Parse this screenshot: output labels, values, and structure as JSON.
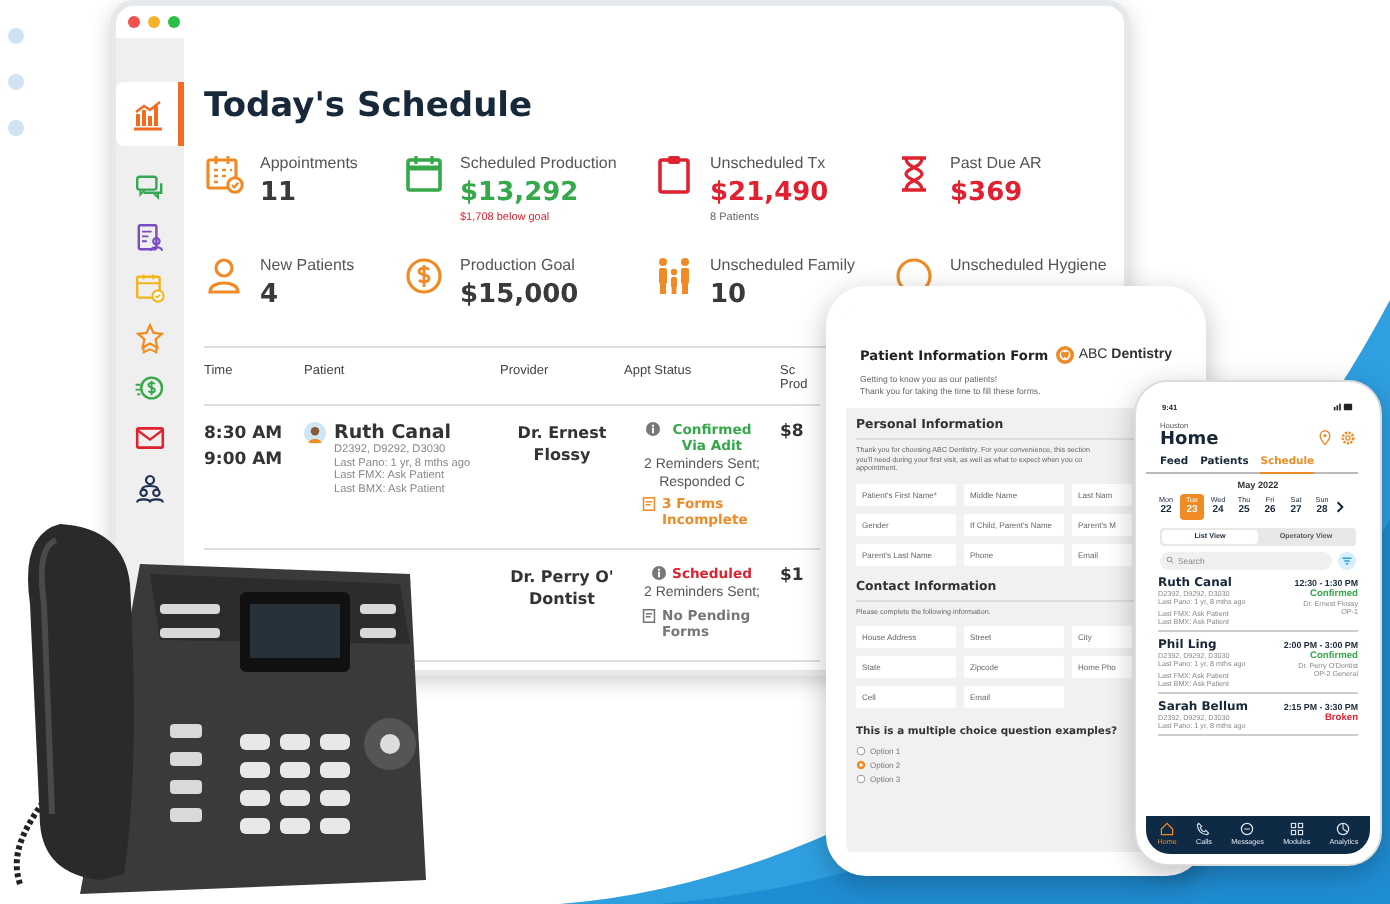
{
  "monitor": {
    "sidebar": {
      "items": [
        {
          "selected": true
        },
        {
          "selected": false
        },
        {
          "selected": false
        },
        {
          "selected": false
        },
        {
          "selected": false
        },
        {
          "selected": false
        },
        {
          "selected": false
        },
        {
          "selected": false
        }
      ]
    },
    "title": "Today's Schedule",
    "stats": [
      {
        "label": "Appointments",
        "value": "11"
      },
      {
        "label": "Scheduled Production",
        "value": "$13,292",
        "color": "#35a94a",
        "note": {
          "text": "$1,708 below goal",
          "color": "#e0212f"
        }
      },
      {
        "label": "Unscheduled Tx",
        "value": "$21,490",
        "color": "#e0212f",
        "note": {
          "text": "8 Patients"
        }
      },
      {
        "label": "Past Due AR",
        "value": "$369",
        "color": "#e0212f"
      },
      {
        "label": "New Patients",
        "value": "4"
      },
      {
        "label": "Production Goal",
        "value": "$15,000"
      },
      {
        "label": "Unscheduled Family",
        "value": "10"
      },
      {
        "label": "Unscheduled Hygiene"
      }
    ],
    "table": {
      "columns": [
        "Time",
        "Patient",
        "Provider",
        "Appt Status",
        "Sc Prod"
      ],
      "rows": [
        {
          "times": [
            "8:30 AM",
            "9:00 AM"
          ],
          "patient": {
            "name": "Ruth Canal",
            "details": [
              "D2392, D9292, D3030",
              "Last Pano: 1 yr, 8 mths ago",
              "Last FMX: Ask Patient",
              "Last BMX: Ask Patient"
            ]
          },
          "provider": "Dr. Ernest Flossy",
          "status": {
            "label": "Confirmed Via Adit",
            "color": "#35a94a",
            "note": "2 Reminders Sent; Responded C",
            "forms": {
              "label": "3 Forms Incomplete",
              "color": "#f08a24"
            }
          },
          "production": "$8"
        },
        {
          "provider": "Dr. Perry O' Dontist",
          "status": {
            "label": "Scheduled",
            "color": "#e0212f",
            "note": "2 Reminders Sent;",
            "forms": {
              "label": "No Pending Forms",
              "color": "#777777"
            }
          },
          "production": "$1"
        }
      ]
    }
  },
  "tablet": {
    "title": "Patient Information Form",
    "logo": "ABC **Dentistry**",
    "intro": [
      "Getting to know you as our patients!",
      "Thank you for taking the time to fill these forms."
    ],
    "sections": [
      {
        "heading": "Personal Information",
        "lines": [
          "Thank you for choosing ABC Dentistry. For your convenience, this section",
          "you'll need during your first visit, as well as what to expect when you co",
          "appointment."
        ],
        "fields": [
          "Patient's First Name*",
          "Middle Name",
          "Last Nam",
          "Gender",
          "If Child, Parent's Name",
          "Parent's M",
          "Parent's Last Name",
          "Phone",
          "Email"
        ]
      },
      {
        "heading": "Contact Information",
        "lines": [
          "Please complete the following information."
        ],
        "fields": [
          "House Address",
          "Street",
          "City",
          "State",
          "Zipcode",
          "Home Pho",
          "Cell",
          "Email"
        ]
      }
    ],
    "question": "This is a multiple choice question examples?",
    "options": [
      {
        "label": "Option 1",
        "selected": false
      },
      {
        "label": "Option 2",
        "selected": true
      },
      {
        "label": "Option 3",
        "selected": false
      }
    ]
  },
  "phone": {
    "time": "9:41",
    "location": "Houston",
    "title": "Home",
    "tabs": [
      {
        "label": "Feed",
        "selected": false
      },
      {
        "label": "Patients",
        "selected": false
      },
      {
        "label": "Schedule",
        "selected": true
      }
    ],
    "month": "May 2022",
    "days": [
      {
        "day": "Mon",
        "date": "22",
        "selected": false
      },
      {
        "day": "Tue",
        "date": "23",
        "selected": true
      },
      {
        "day": "Wed",
        "date": "24",
        "selected": false
      },
      {
        "day": "Thu",
        "date": "25",
        "selected": false
      },
      {
        "day": "Fri",
        "date": "26",
        "selected": false
      },
      {
        "day": "Sat",
        "date": "27",
        "selected": false
      },
      {
        "day": "Sun",
        "date": "28",
        "selected": false
      }
    ],
    "views": [
      {
        "label": "List View",
        "selected": true
      },
      {
        "label": "Operatory View",
        "selected": false
      }
    ],
    "search": {
      "placeholder": "Search"
    },
    "appointments": [
      {
        "name": "Ruth Canal",
        "time": "12:30 - 1:30 PM",
        "details": [
          "D2392, D9292, D3030",
          "Last Pano: 1 yr, 8 mths ago"
        ],
        "more": [
          "Last FMX: Ask Patient",
          "Last BMX: Ask Patient"
        ],
        "status": {
          "label": "Confirmed",
          "color": "#35a94a"
        },
        "provider": [
          "Dr. Ernest Flossy",
          "OP-1"
        ]
      },
      {
        "name": "Phil Ling",
        "time": "2:00 PM - 3:00 PM",
        "details": [
          "D2392, D9292, D3030",
          "Last Pano: 1 yr, 8 mths ago"
        ],
        "more": [
          "Last FMX: Ask Patient",
          "Last BMX: Ask Patient"
        ],
        "status": {
          "label": "Confirmed",
          "color": "#35a94a"
        },
        "provider": [
          "Dr. Perry O'Dontist",
          "OP-2 General"
        ]
      },
      {
        "name": "Sarah Bellum",
        "time": "2:15 PM - 3:30 PM",
        "details": [
          "D2392, D9292, D3030",
          "Last Pano: 1 yr, 8 mths ago"
        ],
        "status": {
          "label": "Broken",
          "color": "#e0212f"
        }
      }
    ],
    "nav": [
      {
        "label": "Home",
        "selected": true
      },
      {
        "label": "Calls",
        "selected": false
      },
      {
        "label": "Messages",
        "selected": false
      },
      {
        "label": "Modules",
        "selected": false
      },
      {
        "label": "Analytics",
        "selected": false
      }
    ]
  }
}
